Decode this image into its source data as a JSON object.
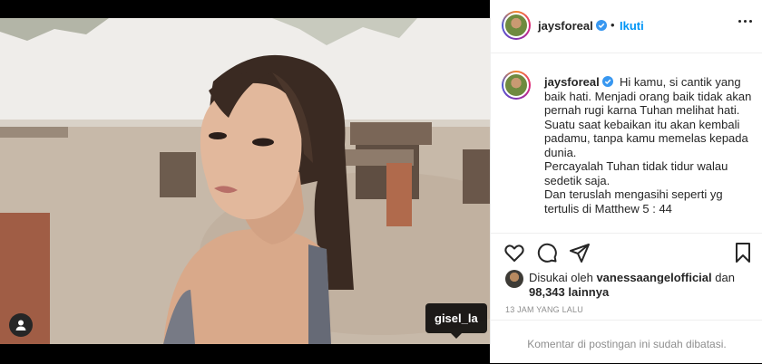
{
  "post": {
    "tagged_user": "gisel_la"
  },
  "header": {
    "username": "jaysforeal",
    "dot": "•",
    "follow_label": "Ikuti"
  },
  "caption": {
    "username": "jaysforeal",
    "lines": [
      "Hi kamu, si cantik yang baik hati. Menjadi orang baik tidak akan pernah rugi karna Tuhan melihat hati.",
      "Suatu saat kebaikan itu akan kembali padamu, tanpa kamu memelas kepada dunia.",
      "Percayalah Tuhan tidak tidur walau sedetik saja.",
      "Dan teruslah mengasihi seperti yg tertulis di Matthew 5 : 44"
    ]
  },
  "likes": {
    "prefix": "Disukai oleh",
    "liker": "vanessaangelofficial",
    "and": "dan",
    "count": "98,343 lainnya"
  },
  "timestamp": "13 JAM YANG LALU",
  "comments_disabled": "Komentar di postingan ini sudah dibatasi.",
  "icons": [
    "user-tag-icon",
    "verified-icon",
    "more-options-icon",
    "heart-icon",
    "comment-icon",
    "share-icon",
    "save-icon"
  ],
  "colors": {
    "link_blue": "#0095f6",
    "verified_blue": "#3897f0",
    "text": "#262626",
    "muted": "#8e8e8e"
  }
}
